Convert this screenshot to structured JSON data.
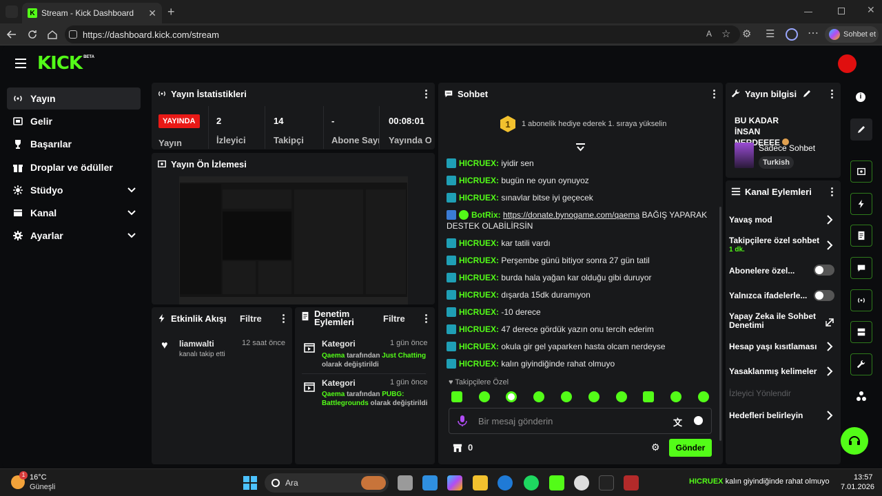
{
  "browser": {
    "tab_title": "Stream - Kick Dashboard",
    "url": "https://dashboard.kick.com/stream",
    "copilot_label": "Sohbet et"
  },
  "header": {
    "logo": "KICK",
    "logo_badge": "BETA"
  },
  "nav": [
    {
      "label": "Yayın",
      "active": true,
      "icon": "broadcast-icon"
    },
    {
      "label": "Gelir",
      "icon": "revenue-icon"
    },
    {
      "label": "Başarılar",
      "icon": "trophy-icon"
    },
    {
      "label": "Droplar ve ödüller",
      "icon": "gift-icon"
    },
    {
      "label": "Stüdyo",
      "icon": "studio-icon",
      "expandable": true
    },
    {
      "label": "Kanal",
      "icon": "channel-icon",
      "expandable": true
    },
    {
      "label": "Ayarlar",
      "icon": "settings-icon",
      "expandable": true
    }
  ],
  "stats": {
    "title": "Yayın İstatistikleri",
    "live_badge": "YAYINDA",
    "items": [
      {
        "value": "",
        "label": "Yayın"
      },
      {
        "value": "2",
        "label": "İzleyici"
      },
      {
        "value": "14",
        "label": "Takipçi"
      },
      {
        "value": "-",
        "label": "Abone Sayısı"
      },
      {
        "value": "00:08:01",
        "label": "Yayında Olduğu"
      }
    ]
  },
  "preview": {
    "title": "Yayın Ön İzlemesi"
  },
  "activity": {
    "title": "Etkinlik Akışı",
    "filter": "Filtre",
    "events": [
      {
        "user": "liamwalti",
        "time": "12 saat önce",
        "text": "kanalı takip etti"
      }
    ]
  },
  "mod": {
    "title": "Denetim Eylemleri",
    "filter": "Filtre",
    "items": [
      {
        "title": "Kategori",
        "time": "1 gün önce",
        "actor": "Qaema",
        "mid": " tarafından ",
        "category": "Just Chatting",
        "tail": " olarak değiştirildi"
      },
      {
        "title": "Kategori",
        "time": "1 gün önce",
        "actor": "Qaema",
        "mid": " tarafından ",
        "category": "PUBG: Battlegrounds",
        "tail": " olarak değiştirildi"
      }
    ]
  },
  "chat": {
    "title": "Sohbet",
    "gift_rank": "1",
    "gift_text": "1 abonelik hediye ederek 1. sıraya yükselin",
    "messages": [
      {
        "user": "HICRUEX:",
        "text": "iyidir sen"
      },
      {
        "user": "HICRUEX:",
        "text": "bugün ne oyun oynuyoz"
      },
      {
        "user": "HICRUEX:",
        "text": "sınavlar bitse iyi geçecek"
      },
      {
        "user": "BotRix:",
        "link": "https://donate.bynogame.com/qaema",
        "text": " BAĞIŞ YAPARAK",
        "text2": "DESTEK OLABİLİRSİN"
      },
      {
        "user": "HICRUEX:",
        "text": "kar tatili vardı"
      },
      {
        "user": "HICRUEX:",
        "text": "Perşembe günü bitiyor sonra 27 gün tatil"
      },
      {
        "user": "HICRUEX:",
        "text": "burda hala yağan kar olduğu gibi duruyor"
      },
      {
        "user": "HICRUEX:",
        "text": "dışarda 15dk duramıyon"
      },
      {
        "user": "HICRUEX:",
        "text": "-10 derece"
      },
      {
        "user": "HICRUEX:",
        "text": "47 derece gördük yazın onu tercih ederim"
      },
      {
        "user": "HICRUEX:",
        "text": "okula gir gel yaparken hasta olcam nerdeyse"
      },
      {
        "user": "HICRUEX:",
        "text": "kalın giyindiğinde rahat olmuyo"
      }
    ],
    "followers_only": "Takipçilere Özel",
    "input_placeholder": "Bir mesaj gönderin",
    "points": "0",
    "send": "Gönder"
  },
  "stream_info": {
    "title": "Yayın bilgisi",
    "stream_title": "BU KADAR İNSAN NERDEEEE",
    "category": "Sadece Sohbet",
    "language": "Turkish"
  },
  "channel_actions": {
    "title": "Kanal Eylemleri",
    "items": [
      {
        "label": "Yavaş mod",
        "type": "chevron"
      },
      {
        "label": "Takipçilere özel sohbet",
        "sub": "1 dk.",
        "type": "chevron"
      },
      {
        "label": "Abonelere özel...",
        "type": "toggle"
      },
      {
        "label": "Yalnızca ifadelerle...",
        "type": "toggle"
      },
      {
        "label": "Yapay Zeka ile Sohbet Denetimi",
        "type": "external"
      },
      {
        "label": "Hesap yaşı kısıtlaması",
        "type": "chevron"
      },
      {
        "label": "Yasaklanmış kelimeler",
        "type": "chevron"
      },
      {
        "label": "İzleyici Yönlendir",
        "type": "disabled"
      },
      {
        "label": "Hedefleri belirleyin",
        "type": "chevron"
      }
    ]
  },
  "taskbar": {
    "weather_temp": "16°C",
    "weather_desc": "Güneşli",
    "weather_badge": "1",
    "search": "Ara",
    "ticker_user": "HICRUEX",
    "ticker_text": "kalın giyindiğinde rahat olmuyo",
    "time": "13:57",
    "date": "7.01.2026"
  },
  "colors": {
    "accent": "#53fc18",
    "live": "#e91916",
    "bg": "#0b0c0e",
    "panel": "#18191b"
  }
}
